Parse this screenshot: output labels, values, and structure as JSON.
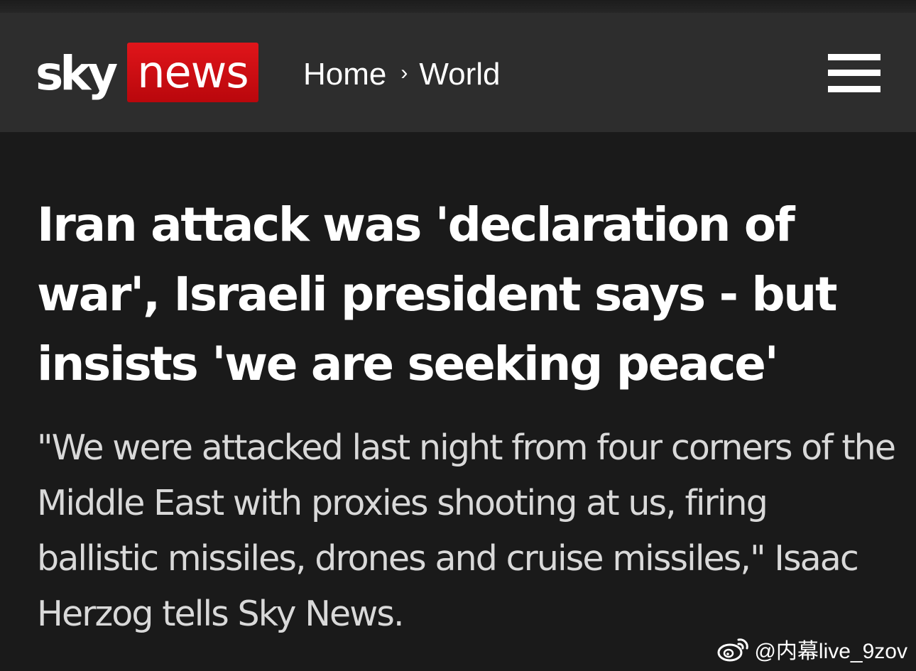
{
  "header": {
    "logo": {
      "sky": "sky",
      "news": "news"
    },
    "breadcrumb": {
      "items": [
        "Home",
        "World"
      ],
      "separator": "›"
    },
    "menu_icon": "hamburger-menu-icon"
  },
  "article": {
    "headline": "Iran attack was 'declaration of war', Israeli president says - but insists 'we are seeking peace'",
    "standfirst": "\"We were attacked last night from four corners of the Middle East with proxies shooting at us, firing ballistic missiles, drones and cruise missiles,\" Isaac Herzog tells Sky News."
  },
  "watermark": {
    "icon": "weibo-icon",
    "handle": "@内幕live_9zov"
  },
  "colors": {
    "background": "#1a1a1a",
    "header": "#2d2d2d",
    "brand_red": "#d0101a",
    "text": "#ffffff",
    "standfirst_text": "#d9d9d9"
  }
}
